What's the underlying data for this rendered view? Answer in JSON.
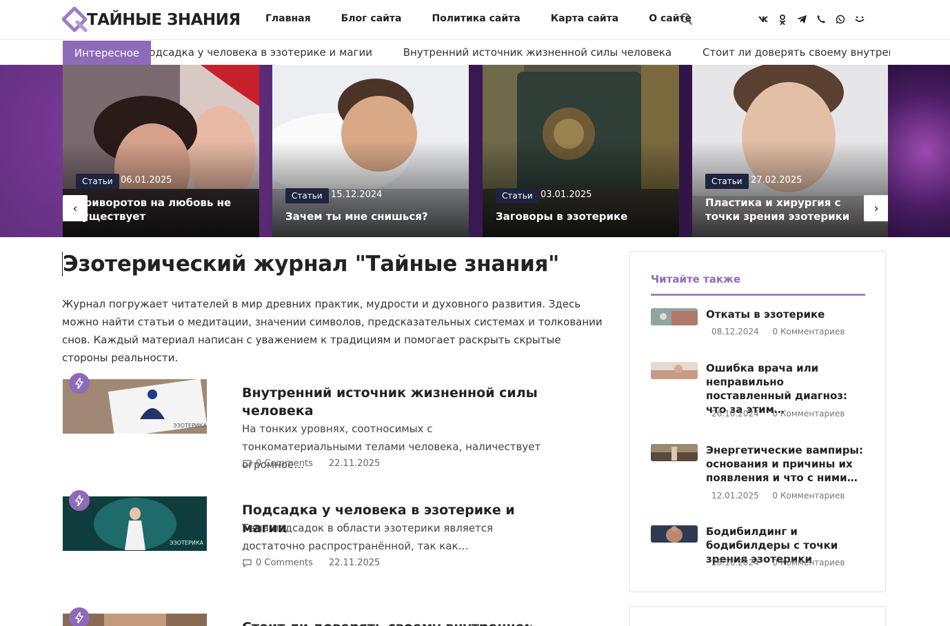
{
  "site": {
    "logo_text": "ТАЙНЫЕ ЗНАНИЯ",
    "accent_color": "#8e6bb8"
  },
  "nav": {
    "items": [
      "Главная",
      "Блог сайта",
      "Политика сайта",
      "Карта сайта",
      "О сайте"
    ]
  },
  "icons": {
    "search": "search-icon",
    "socials": [
      "vk-icon",
      "odnoklassniki-icon",
      "telegram-icon",
      "viber-icon",
      "whatsapp-icon",
      "moimir-icon"
    ]
  },
  "ticker": {
    "label": "Интересное",
    "items": [
      "Подсадка у человека в эзотерике и магии",
      "Внутренний источник жизненной силы человека",
      "Стоит ли доверять своему внутреннему голосу"
    ]
  },
  "slider": {
    "prev": "‹",
    "next": "›",
    "slides": [
      {
        "category": "Статьи",
        "date": "06.01.2025",
        "title": "Приворотов на любовь не существует"
      },
      {
        "category": "Статьи",
        "date": "15.12.2024",
        "title": "Зачем ты мне снишься?"
      },
      {
        "category": "Статьи",
        "date": "03.01.2025",
        "title": "Заговоры в эзотерике"
      },
      {
        "category": "Статьи",
        "date": "27.02.2025",
        "title": "Пластика и хирургия с точки зрения эзотерики"
      }
    ]
  },
  "main": {
    "title": "Эзотерический журнал \"Тайные знания\"",
    "intro": "Журнал погружает читателей в мир древних практик, мудрости и духовного развития. Здесь можно найти статьи о медитации, значении символов, предсказательных системах и толковании снов. Каждый материал написан с уважением к традициям и помогает раскрыть скрытые стороны реальности.",
    "posts": [
      {
        "title": "Внутренний источник жизненной силы человека",
        "excerpt": "На тонких уровнях, соотносимых с тонкоматериальными телами человека, наличествует огромное…",
        "comments": "0 Comments",
        "date": "22.11.2025",
        "thumb_caption": "ЭЗОТЕРИКА"
      },
      {
        "title": "Подсадка у человека в эзотерике и магии",
        "excerpt": "Тема подсадок в области эзотерики является достаточно распространённой, так как…",
        "comments": "0 Comments",
        "date": "22.11.2025",
        "thumb_caption": "ЭЗОТЕРИКА"
      },
      {
        "title": "Стоит ли доверять своему внутреннему",
        "excerpt": "",
        "comments": "",
        "date": "",
        "thumb_caption": ""
      }
    ]
  },
  "sidebar": {
    "heading": "Читайте также",
    "items": [
      {
        "title": "Откаты в эзотерике",
        "date": "08.12.2024",
        "comments": "0 Комментариев"
      },
      {
        "title": "Ошибка врача или неправильно поставленный диагноз: что за этим…",
        "date": "26.10.2024",
        "comments": "0 Комментариев"
      },
      {
        "title": "Энергетические вампиры: основания и причины их появления и что с ними…",
        "date": "12.01.2025",
        "comments": "0 Комментариев"
      },
      {
        "title": "Бодибилдинг и бодибилдеры с точки зрения эзотерики",
        "date": "28.10.2024",
        "comments": "0 Комментариев"
      }
    ]
  }
}
